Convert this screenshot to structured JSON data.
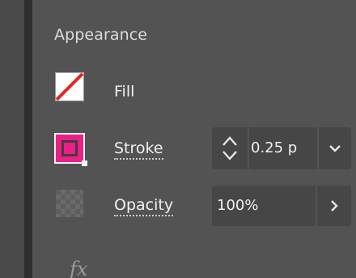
{
  "panel": {
    "title": "Appearance",
    "fill": {
      "label": "Fill",
      "swatch": "none"
    },
    "stroke": {
      "label": "Stroke",
      "color": "#EC1F87",
      "weight_value": "0.25 p",
      "stepper_icons": [
        "chevron-up-icon",
        "chevron-down-icon"
      ],
      "dropdown_icon": "chevron-down-icon"
    },
    "opacity": {
      "label": "Opacity",
      "value": "100%",
      "arrow_icon": "chevron-right-icon"
    },
    "fx_label": "fx"
  }
}
